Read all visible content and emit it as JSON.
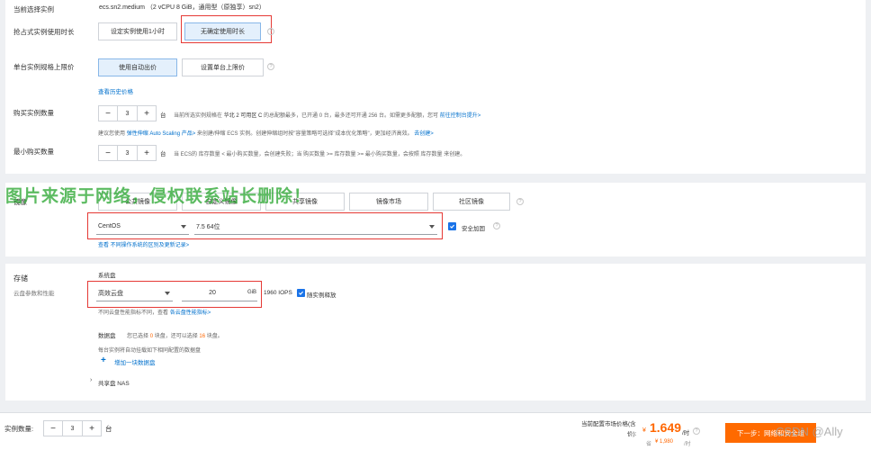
{
  "instance": {
    "current_label": "当前选择实例",
    "current_value": "ecs.sn2.medium （2 vCPU 8 GiB，通用型（原独享）sn2）",
    "preempt_label": "抢占式实例使用时长",
    "preempt_opt1": "设定实例使用1小时",
    "preempt_opt2": "无确定使用时长",
    "price_label": "单台实例规格上限价",
    "price_opt1": "使用自动出价",
    "price_opt2": "设置单台上限价",
    "history_link": "查看历史价格",
    "qty_label": "购买实例数量",
    "qty_value": "3",
    "qty_unit": "台",
    "qty_note_1": "当前所选实例规格在",
    "qty_note_region": "华北 2 可用区 C",
    "qty_note_2": "的总配额最多，已开通 0 台，最多还可开通 256 台。如需更多配额，您可",
    "qty_note_link": "前往控制台提升>",
    "scaling_note_1": "建议您使用",
    "scaling_link": "弹性伸缩 Auto Scaling 产品>",
    "scaling_note_2": "来创建/伸缩 ECS 实例。创建伸缩组时按\"容量策略可选择\"成本优化策略\"，更加经济高效。",
    "scaling_link2": "去创建>",
    "min_label": "最小购买数量",
    "min_value": "3",
    "min_unit": "台",
    "min_note": "当 ECS的 库存数量 < 最小购买数量，会创建失败；当 购买数量 >= 库存数量 >= 最小购买数量，会按照 库存数量 来创建。"
  },
  "watermark": "图片来源于网络，侵权联系站长删除！",
  "image": {
    "label": "镜像",
    "tabs": [
      "公共镜像",
      "自定义镜像",
      "共享镜像",
      "镜像市场",
      "社区镜像"
    ],
    "os_value": "CentOS",
    "version_value": "7.5 64位",
    "security_label": "安全加固",
    "note": "查看 不同操作系统的区别及更新记录>"
  },
  "storage": {
    "label": "存储",
    "sublabel": "云盘参数和性能",
    "system_disk_label": "系统盘",
    "disk_type": "高效云盘",
    "disk_size": "20",
    "disk_unit": "GiB",
    "iops": "1960 IOPS",
    "release_label": "随实例释放",
    "perf_note_1": "不同云盘性能指标不同，查看",
    "perf_link": "各云盘性能指标>",
    "data_disk_label": "数据盘",
    "data_note_1": "您已选择",
    "data_selected": "0",
    "data_note_2": "块盘，还可以选择",
    "data_remaining": "16",
    "data_note_3": "块盘。",
    "data_auto_note": "每台实例将自动挂载如下相同配置的数据盘",
    "add_disk": "增加一块数据盘",
    "nas_label": "共享盘 NAS"
  },
  "footer": {
    "qty_label": "实例数量:",
    "qty_value": "3",
    "qty_unit": "台",
    "price_label_1": "当前配置市场价格(含",
    "price_label_2": "价):",
    "currency": "¥",
    "price": "1.649",
    "price_unit": "/时",
    "save_label": "省",
    "orig_price": "¥ 1,980",
    "orig_unit": "/时",
    "next_button": "下一步：网络和安全组",
    "csdn_mark": "CSDN @Ally"
  }
}
